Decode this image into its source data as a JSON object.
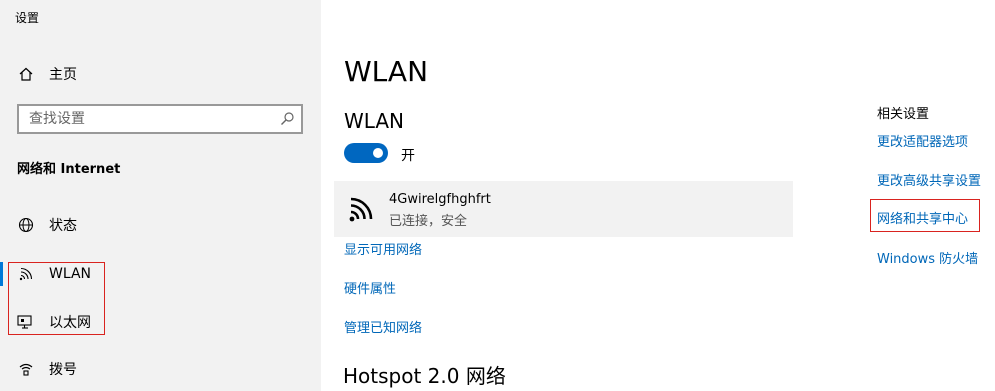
{
  "app": {
    "title": "设置"
  },
  "sidebar": {
    "home_label": "主页",
    "search": {
      "placeholder": "查找设置",
      "value": ""
    },
    "section_title": "网络和 Internet",
    "items": [
      {
        "label": "状态",
        "icon": "globe-icon"
      },
      {
        "label": "WLAN",
        "icon": "wifi-icon",
        "active": true
      },
      {
        "label": "以太网",
        "icon": "ethernet-icon"
      },
      {
        "label": "拨号",
        "icon": "dialup-icon"
      }
    ]
  },
  "main": {
    "page_title": "WLAN",
    "wlan_section_title": "WLAN",
    "toggle": {
      "state_label": "开",
      "on": true
    },
    "network": {
      "name": "4Gwirelgfhghfrt",
      "status": "已连接，安全"
    },
    "links": [
      "显示可用网络",
      "硬件属性",
      "管理已知网络"
    ],
    "hotspot_title": "Hotspot 2.0 网络"
  },
  "related": {
    "title": "相关设置",
    "links": [
      "更改适配器选项",
      "更改高级共享设置",
      "网络和共享中心",
      "Windows 防火墙"
    ]
  },
  "colors": {
    "accent": "#0067c0",
    "link": "#0067b8",
    "sidebar_bg": "#f2f2f2",
    "highlight_box": "#d9231f"
  }
}
